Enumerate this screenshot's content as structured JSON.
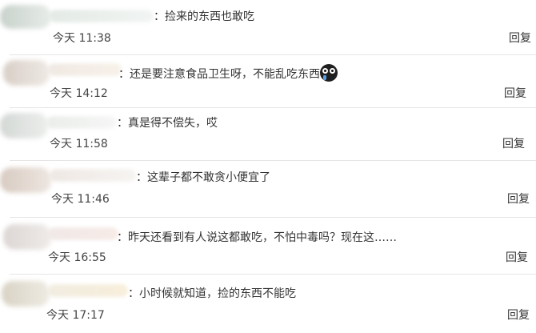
{
  "colors": {
    "text": "#333333",
    "time": "#444444",
    "divider": "#e6e6e6",
    "emoji_face": "#1f1f1f"
  },
  "comments": [
    {
      "content": "：捡来的东西也敢吃",
      "time": "今天 11:38",
      "reply": "回复"
    },
    {
      "content": "：还是要注意食品卫生呀，不能乱吃东西",
      "emoji": "crying-face-icon",
      "time": "今天 14:12",
      "reply": "回复"
    },
    {
      "content": "：真是得不偿失，哎",
      "time": "今天 11:58",
      "reply": "回复"
    },
    {
      "content": "：这辈子都不敢贪小便宜了",
      "time": "今天 11:46",
      "reply": "回复"
    },
    {
      "content": "：昨天还看到有人说这都敢吃，不怕中毒吗？现在这……",
      "time": "今天 16:55",
      "reply": "回复"
    },
    {
      "content": "：小时候就知道，捡的东西不能吃",
      "time": "今天 17:17",
      "reply": "回复"
    }
  ]
}
